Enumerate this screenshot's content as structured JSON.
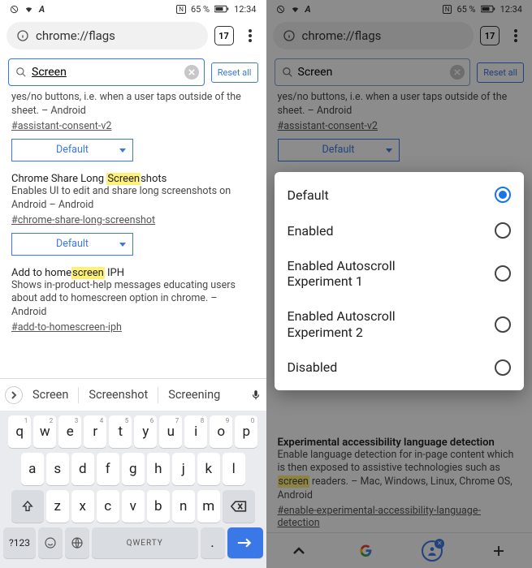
{
  "status": {
    "nfc": "N",
    "battery": "65 %",
    "time": "12:34"
  },
  "urlbar": {
    "url": "chrome://flags",
    "tabCount": "17"
  },
  "search": {
    "value": "Screen",
    "reset": "Reset all"
  },
  "left": {
    "partialDesc": "yes/no buttons, i.e. when a user taps outside of the sheet. – Android",
    "partialAnchor": "#assistant-consent-v2",
    "dropdownDefault": "Default",
    "flag2": {
      "titlePre": "Chrome Share Long ",
      "hl": "Screen",
      "titlePost": "shots",
      "desc": "Enables UI to edit and share long screenshots on Android – Android",
      "anchor": "#chrome-share-long-screenshot"
    },
    "flag3": {
      "titlePre": "Add to home",
      "hl": "screen",
      "titlePost": " IPH",
      "desc": "Shows in-product-help messages educating users about add to homescreen option in chrome. – Android",
      "anchor": "#add-to-homescreen-iph"
    },
    "suggestions": [
      "Screen",
      "Screenshot",
      "Screening"
    ],
    "qRow": [
      "q",
      "w",
      "e",
      "r",
      "t",
      "y",
      "u",
      "i",
      "o",
      "p"
    ],
    "qNums": [
      "1",
      "2",
      "3",
      "4",
      "5",
      "6",
      "7",
      "8",
      "9",
      "0"
    ],
    "aRow": [
      "a",
      "s",
      "d",
      "f",
      "g",
      "h",
      "j",
      "k",
      "l"
    ],
    "zRow": [
      "z",
      "x",
      "c",
      "v",
      "b",
      "n",
      "m"
    ],
    "symKey": "?123",
    "spaceLabel": "QWERTY"
  },
  "right": {
    "options": [
      "Default",
      "Enabled",
      "Enabled Autoscroll Experiment 1",
      "Enabled Autoscroll Experiment 2",
      "Disabled"
    ],
    "bgflag": {
      "title": "Experimental accessibility language detection",
      "descPre": "Enable language detection for in-page content which is then exposed to assistive technologies such as ",
      "hl": "screen",
      "descPost": " readers. – Mac, Windows, Linux, Chrome OS, Android",
      "anchor": "#enable-experimental-accessibility-language-detection"
    }
  }
}
